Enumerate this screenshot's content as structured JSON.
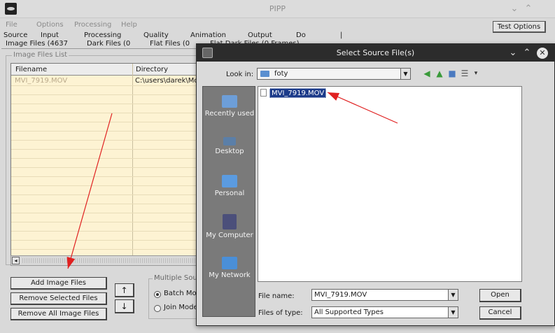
{
  "main": {
    "title": "PIPP",
    "menu": [
      "File",
      "Options",
      "Processing",
      "Help"
    ],
    "test_options": "Test Options",
    "tabs_top": [
      "Source",
      "Input",
      "Processing",
      "Quality",
      "Animation",
      "Output",
      "Do"
    ],
    "tabs_sub": [
      "Image Files (4637",
      "Dark Files (0",
      "Flat Files (0",
      "Flat Dark Files (0 Frames)"
    ],
    "list_legend": "Image Files List",
    "columns": [
      "Filename",
      "Directory"
    ],
    "rows": [
      {
        "filename": "MVI_7919.MOV",
        "directory": "C:\\users\\darek\\Moje"
      }
    ],
    "add_button": "Add Image Files",
    "remove_selected": "Remove Selected Files",
    "remove_all": "Remove All Image Files",
    "up_arrow": "↑",
    "down_arrow": "↓",
    "multi_legend": "Multiple Sourc",
    "batch_mode": "Batch Mod",
    "join_mode": "Join Mode"
  },
  "dialog": {
    "title": "Select Source File(s)",
    "look_in_label": "Look in:",
    "look_in_value": "foty",
    "places": [
      "Recently used",
      "Desktop",
      "Personal",
      "My Computer",
      "My Network"
    ],
    "files": [
      "MVI_7919.MOV"
    ],
    "file_name_label": "File name:",
    "file_name_value": "MVI_7919.MOV",
    "file_type_label": "Files of type:",
    "file_type_value": "All Supported Types",
    "open_button": "Open",
    "cancel_button": "Cancel"
  },
  "colors": {
    "annotation": "#e02020",
    "selection": "#1c3b8a",
    "table_bg": "#fdf3d3"
  }
}
